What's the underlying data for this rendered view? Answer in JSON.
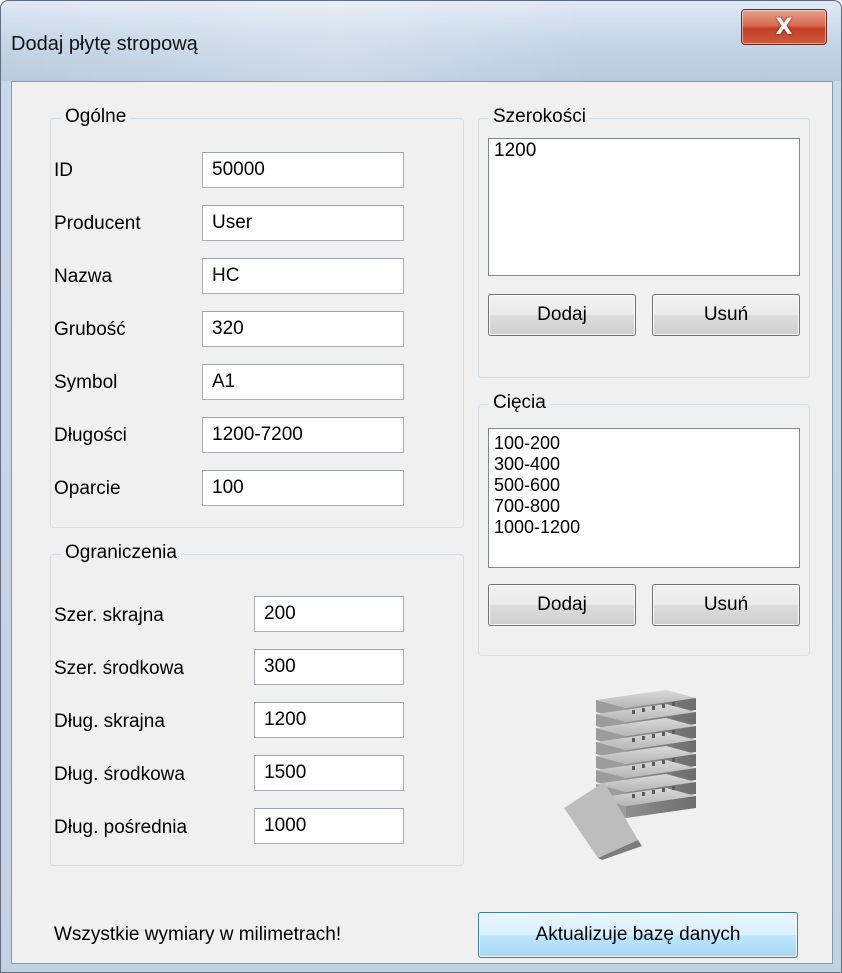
{
  "window": {
    "title": "Dodaj płytę stropową",
    "close_symbol": "X"
  },
  "general": {
    "title": "Ogólne",
    "fields": [
      {
        "label": "ID",
        "value": "50000"
      },
      {
        "label": "Producent",
        "value": "User"
      },
      {
        "label": "Nazwa",
        "value": "HC"
      },
      {
        "label": "Grubość",
        "value": "320"
      },
      {
        "label": "Symbol",
        "value": "A1"
      },
      {
        "label": "Długości",
        "value": "1200-7200"
      },
      {
        "label": "Oparcie",
        "value": "100"
      }
    ]
  },
  "limits": {
    "title": "Ograniczenia",
    "fields": [
      {
        "label": "Szer. skrajna",
        "value": "200"
      },
      {
        "label": "Szer. środkowa",
        "value": "300"
      },
      {
        "label": "Dług. skrajna",
        "value": "1200"
      },
      {
        "label": "Dług. środkowa",
        "value": "1500"
      },
      {
        "label": "Dług. pośrednia",
        "value": "1000"
      }
    ]
  },
  "widths": {
    "title": "Szerokości",
    "items": [
      "1200"
    ],
    "add_label": "Dodaj",
    "remove_label": "Usuń"
  },
  "cuts": {
    "title": "Cięcia",
    "items": [
      "100-200",
      "300-400",
      "500-600",
      "700-800",
      "1000-1200"
    ],
    "add_label": "Dodaj",
    "remove_label": "Usuń"
  },
  "footer": {
    "note": "Wszystkie wymiary w milimetrach!",
    "update_label": "Aktualizuje bazę danych"
  },
  "icons": {
    "close": "close-icon",
    "slabs": "hollow-core-slabs-image"
  }
}
